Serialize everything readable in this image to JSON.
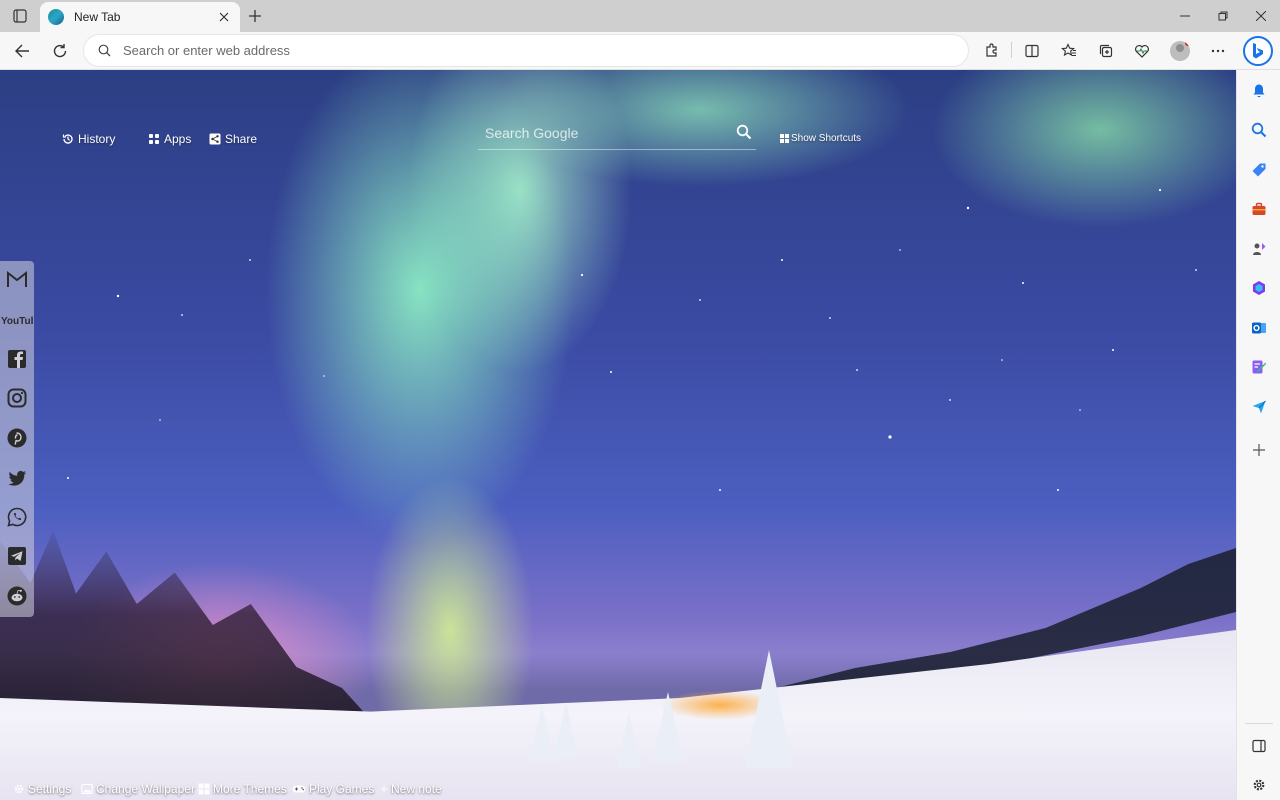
{
  "browser": {
    "tab_title": "New Tab",
    "address_placeholder": "Search or enter web address"
  },
  "newtab": {
    "top_links": [
      {
        "label": "History",
        "icon": "history-icon"
      },
      {
        "label": "Apps",
        "icon": "apps-grid-icon"
      },
      {
        "label": "Share",
        "icon": "share-icon"
      }
    ],
    "search_placeholder": "Search Google",
    "show_shortcuts_label": "Show Shortcuts",
    "social_links": [
      "gmail-icon",
      "youtube-icon",
      "facebook-icon",
      "instagram-icon",
      "pinterest-icon",
      "twitter-icon",
      "whatsapp-icon",
      "telegram-icon",
      "reddit-icon"
    ],
    "youtube_wordmark": "YouTube",
    "bottom_links": [
      {
        "label": "Settings",
        "icon": "gear-icon"
      },
      {
        "label": "Change Wallpaper",
        "icon": "image-icon"
      },
      {
        "label": "More Themes",
        "icon": "windows-grid-icon"
      },
      {
        "label": "Play Games",
        "icon": "gamepad-icon"
      },
      {
        "label": "New note",
        "icon": "plus-icon"
      }
    ]
  },
  "sidebar": {
    "items": [
      "bell-icon",
      "search-icon",
      "shopping-tag-icon",
      "toolbox-icon",
      "games-icon",
      "office-icon",
      "outlook-icon",
      "designer-icon",
      "send-icon",
      "add-icon"
    ],
    "bottom_items": [
      "split-screen-icon",
      "settings-icon"
    ]
  },
  "colors": {
    "accent": "#1a73e8",
    "aurora_green": "#96ffc8",
    "sky_blue": "#3a4aa2",
    "snow": "#eeeef7"
  }
}
